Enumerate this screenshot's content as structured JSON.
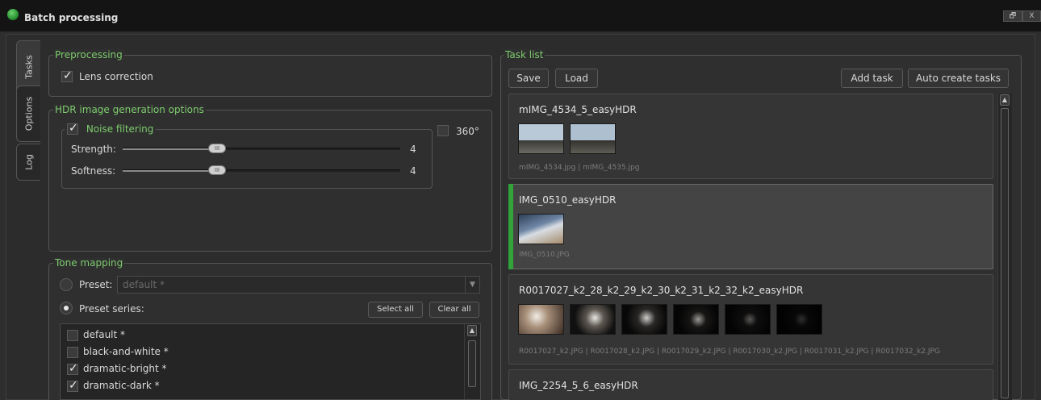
{
  "window": {
    "title": "Batch processing",
    "restore_glyph": "🗗",
    "close_glyph": "X"
  },
  "side_tabs": [
    "Tasks",
    "Options",
    "Log"
  ],
  "preprocessing": {
    "title": "Preprocessing",
    "lens_correction_label": "Lens correction",
    "lens_correction_checked": true
  },
  "hdr_options": {
    "title": "HDR image generation options",
    "noise_filtering_label": "Noise filtering",
    "noise_filtering_checked": true,
    "pano_label": "360°",
    "pano_checked": false,
    "strength_label": "Strength:",
    "strength_value": "4",
    "softness_label": "Softness:",
    "softness_value": "4"
  },
  "tone_mapping": {
    "title": "Tone mapping",
    "preset_label": "Preset:",
    "preset_value": "default *",
    "preset_series_label": "Preset series:",
    "select_all_label": "Select all",
    "clear_all_label": "Clear all",
    "presets": [
      {
        "label": "default *",
        "checked": false
      },
      {
        "label": "black-and-white *",
        "checked": false
      },
      {
        "label": "dramatic-bright *",
        "checked": true
      },
      {
        "label": "dramatic-dark *",
        "checked": true
      }
    ]
  },
  "task_list": {
    "title": "Task list",
    "save_label": "Save",
    "load_label": "Load",
    "add_task_label": "Add task",
    "auto_create_label": "Auto create tasks",
    "tasks": [
      {
        "name": "mIMG_4534_5_easyHDR",
        "files": "mIMG_4534.jpg | mIMG_4535.jpg",
        "selected": false
      },
      {
        "name": "IMG_0510_easyHDR",
        "files": "IMG_0510.JPG",
        "selected": true
      },
      {
        "name": "R0017027_k2_28_k2_29_k2_30_k2_31_k2_32_k2_easyHDR",
        "files": "R0017027_k2.JPG | R0017028_k2.JPG | R0017029_k2.JPG | R0017030_k2.JPG | R0017031_k2.JPG | R0017032_k2.JPG",
        "selected": false
      },
      {
        "name": "IMG_2254_5_6_easyHDR",
        "files": "",
        "selected": false
      }
    ]
  },
  "colors": {
    "accent_green": "#7dcc6d",
    "selected_indicator": "#31a33a",
    "background": "#2e2e2e"
  }
}
